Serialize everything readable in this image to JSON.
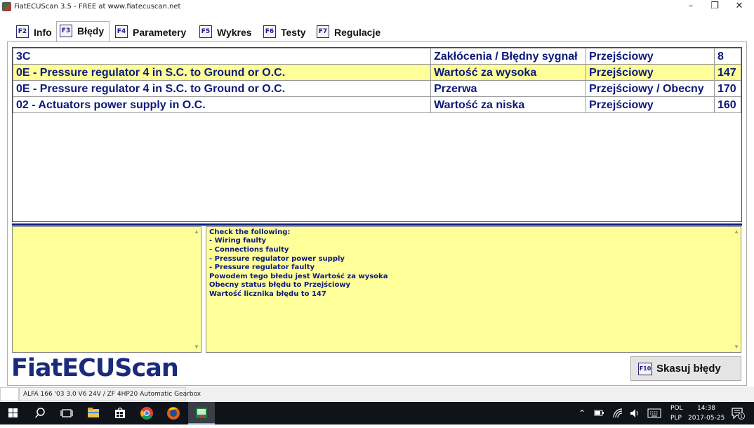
{
  "window": {
    "title": "FiatECUScan 3.5 - FREE at www.fiatecuscan.net",
    "minimize": "–",
    "restore": "❐",
    "close": "✕"
  },
  "tabs": [
    {
      "key": "F2",
      "label": "Info",
      "active": false
    },
    {
      "key": "F3",
      "label": "Błędy",
      "active": true
    },
    {
      "key": "F4",
      "label": "Parametery",
      "active": false
    },
    {
      "key": "F5",
      "label": "Wykres",
      "active": false
    },
    {
      "key": "F6",
      "label": "Testy",
      "active": false
    },
    {
      "key": "F7",
      "label": "Regulacje",
      "active": false
    }
  ],
  "errors": [
    {
      "code": "3C",
      "type": "Zakłócenia / Błędny sygnał",
      "status": "Przejściowy",
      "count": "8"
    },
    {
      "code": "0E - Pressure regulator 4 in S.C. to Ground or O.C.",
      "type": "Wartość za wysoka",
      "status": "Przejściowy",
      "count": "147"
    },
    {
      "code": "0E - Pressure regulator 4 in S.C. to Ground or O.C.",
      "type": "Przerwa",
      "status": "Przejściowy / Obecny",
      "count": "170"
    },
    {
      "code": "02 - Actuators power supply in O.C.",
      "type": "Wartość za niska",
      "status": "Przejściowy",
      "count": "160"
    }
  ],
  "description": {
    "lines": [
      "Check the following:",
      "- Wiring faulty",
      "- Connections faulty",
      "- Pressure regulator power supply",
      "- Pressure regulator faulty",
      "Powodem tego błedu jest Wartość za wysoka",
      "Obecny status błędu to Przejściowy",
      "Wartość licznika błędu to 147"
    ]
  },
  "logo": "FiatECUScan",
  "clear_button": {
    "key": "F10",
    "label": "Skasuj błędy"
  },
  "status_bar": {
    "vehicle": "ALFA 166 '03 3.0 V6 24V / ZF 4HP20 Automatic Gearbox"
  },
  "taskbar": {
    "language_top": "POL",
    "language_bottom": "PLP",
    "time": "14:38",
    "date": "2017-05-25",
    "notification_count": "1"
  },
  "colors": {
    "selection": "#ffff99",
    "text_blue": "#0c1a7a",
    "description_bg": "#ffff99"
  }
}
